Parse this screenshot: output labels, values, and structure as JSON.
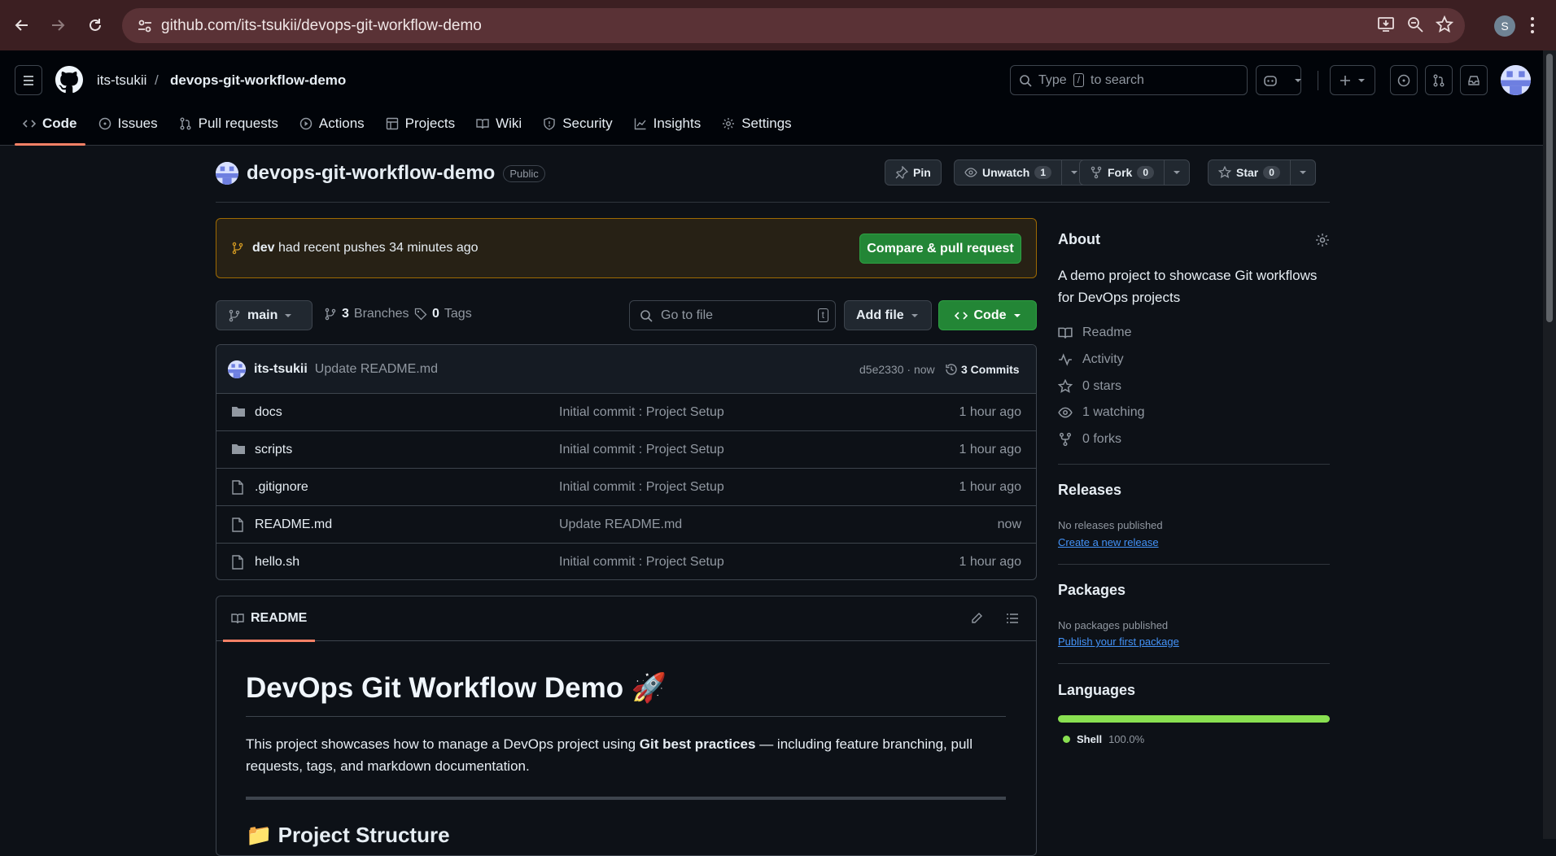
{
  "browser": {
    "url": "github.com/its-tsukii/devops-git-workflow-demo",
    "profile_initial": "S"
  },
  "header": {
    "owner": "its-tsukii",
    "separator": "/",
    "repo": "devops-git-workflow-demo",
    "search_prefix": "Type",
    "search_key": "/",
    "search_suffix": "to search"
  },
  "tabs": [
    {
      "label": "Code",
      "icon": "code-icon",
      "selected": true
    },
    {
      "label": "Issues",
      "icon": "issue-icon"
    },
    {
      "label": "Pull requests",
      "icon": "pull-request-icon"
    },
    {
      "label": "Actions",
      "icon": "play-icon"
    },
    {
      "label": "Projects",
      "icon": "table-icon"
    },
    {
      "label": "Wiki",
      "icon": "book-icon"
    },
    {
      "label": "Security",
      "icon": "shield-icon"
    },
    {
      "label": "Insights",
      "icon": "graph-icon"
    },
    {
      "label": "Settings",
      "icon": "gear-icon"
    }
  ],
  "repo": {
    "name": "devops-git-workflow-demo",
    "visibility": "Public",
    "pin": "Pin",
    "unwatch": "Unwatch",
    "watch_count": "1",
    "fork": "Fork",
    "fork_count": "0",
    "star": "Star",
    "star_count": "0"
  },
  "flash": {
    "branch": "dev",
    "text": "had recent pushes 34 minutes ago",
    "button": "Compare & pull request"
  },
  "toolbar": {
    "branch": "main",
    "branches_count": "3",
    "branches_label": "Branches",
    "tags_count": "0",
    "tags_label": "Tags",
    "goto_placeholder": "Go to file",
    "goto_key": "t",
    "add_file": "Add file",
    "code": "Code"
  },
  "commit": {
    "author": "its-tsukii",
    "message": "Update README.md",
    "sha": "d5e2330 · now",
    "commits": "3 Commits"
  },
  "files": [
    {
      "name": "docs",
      "type": "folder",
      "message": "Initial commit : Project Setup",
      "age": "1 hour ago"
    },
    {
      "name": "scripts",
      "type": "folder",
      "message": "Initial commit : Project Setup",
      "age": "1 hour ago"
    },
    {
      "name": ".gitignore",
      "type": "file",
      "message": "Initial commit : Project Setup",
      "age": "1 hour ago"
    },
    {
      "name": "README.md",
      "type": "file",
      "message": "Update README.md",
      "age": "now"
    },
    {
      "name": "hello.sh",
      "type": "file",
      "message": "Initial commit : Project Setup",
      "age": "1 hour ago"
    }
  ],
  "readme": {
    "tab": "README",
    "title": "DevOps Git Workflow Demo 🚀",
    "para_pre": "This project showcases how to manage a DevOps project using ",
    "para_bold": "Git best practices",
    "para_post": " — including feature branching, pull requests, tags, and markdown documentation.",
    "h2": "📁 Project Structure"
  },
  "about": {
    "title": "About",
    "description": "A demo project to showcase Git workflows for DevOps projects",
    "readme": "Readme",
    "activity": "Activity",
    "stars": "0 stars",
    "watching": "1 watching",
    "forks": "0 forks"
  },
  "releases": {
    "title": "Releases",
    "none": "No releases published",
    "link": "Create a new release"
  },
  "packages": {
    "title": "Packages",
    "none": "No packages published",
    "link": "Publish your first package"
  },
  "languages": {
    "title": "Languages",
    "items": [
      {
        "name": "Shell",
        "percent": "100.0%",
        "color": "#89e051"
      }
    ]
  }
}
